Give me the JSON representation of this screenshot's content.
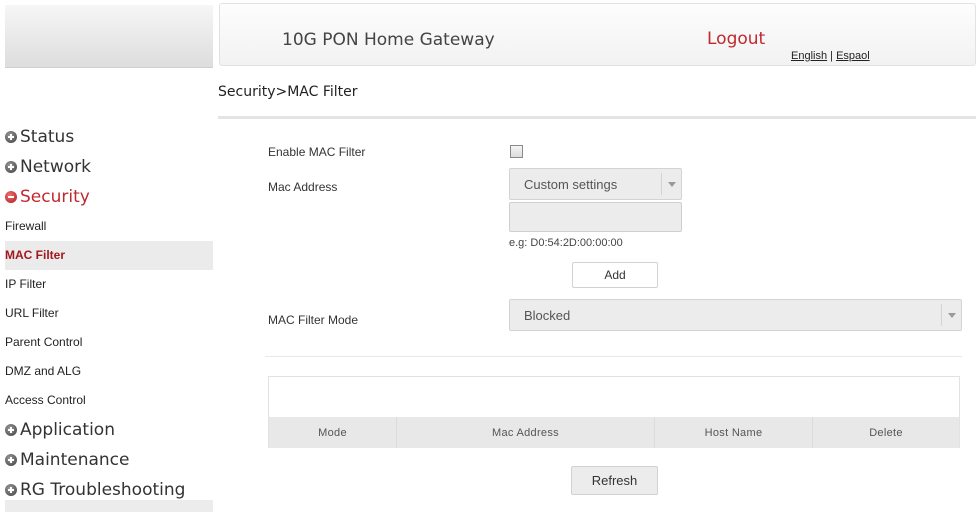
{
  "header": {
    "title": "10G PON Home Gateway",
    "logout": "Logout",
    "lang_english": "English",
    "lang_separator": " | ",
    "lang_spanish": "Espaol"
  },
  "breadcrumb": "Security>MAC Filter",
  "sidebar": {
    "status": "Status",
    "network": "Network",
    "security": "Security",
    "security_items": [
      "Firewall",
      "MAC Filter",
      "IP Filter",
      "URL Filter",
      "Parent Control",
      "DMZ and ALG",
      "Access Control"
    ],
    "application": "Application",
    "maintenance": "Maintenance",
    "rg_troubleshooting": "RG Troubleshooting"
  },
  "form": {
    "enable_label": "Enable MAC Filter",
    "enable_checked": false,
    "mac_address_label": "Mac Address",
    "mac_select_value": "Custom settings",
    "mac_input_value": "",
    "mac_hint": "e.g: D0:54:2D:00:00:00",
    "add_button": "Add",
    "mode_label": "MAC Filter Mode",
    "mode_value": "Blocked"
  },
  "table": {
    "columns": [
      "Mode",
      "Mac Address",
      "Host Name",
      "Delete"
    ],
    "rows": []
  },
  "refresh_button": "Refresh",
  "colors": {
    "accent_red": "#c0282e",
    "active_item": "#a1181e"
  }
}
